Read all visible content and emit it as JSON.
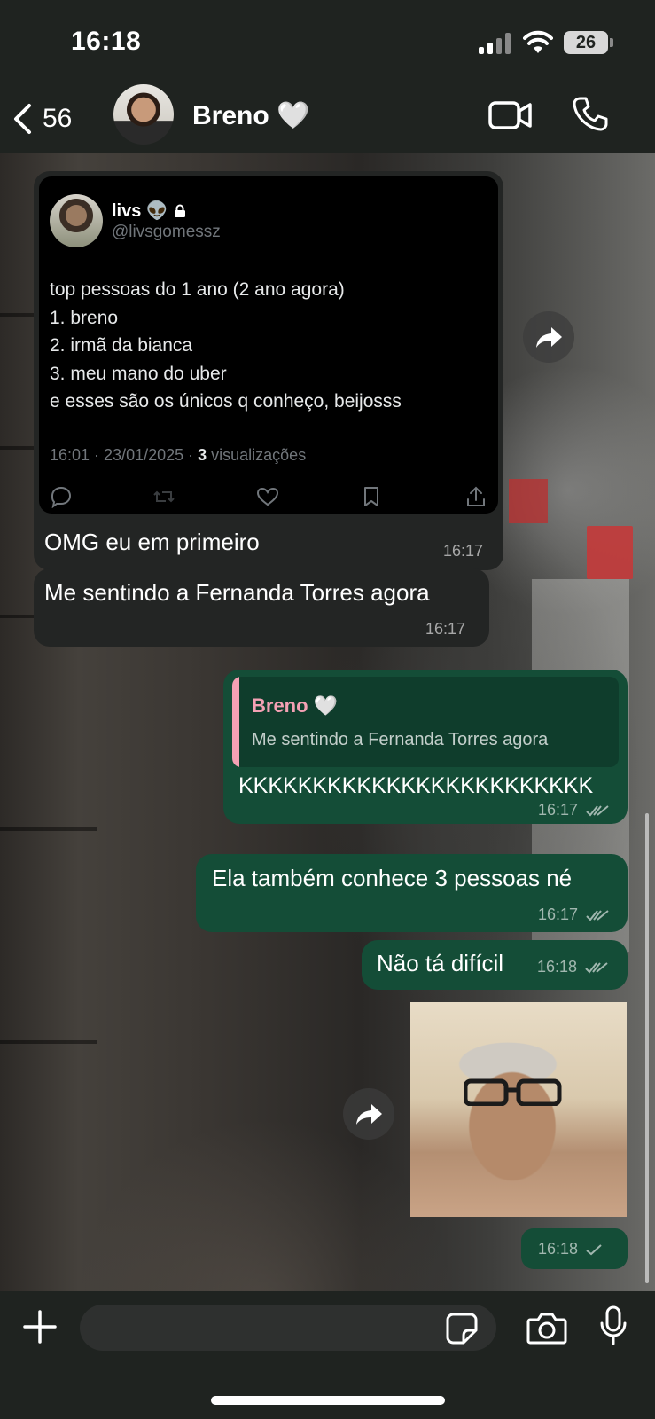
{
  "status_bar": {
    "time": "16:18",
    "battery": "26",
    "icons": [
      "cellular-signal-icon",
      "wifi-icon",
      "battery-icon"
    ]
  },
  "header": {
    "back_count": "56",
    "contact_name": "Breno 🤍",
    "icons": [
      "back-chevron-icon",
      "video-call-icon",
      "phone-icon"
    ]
  },
  "messages": [
    {
      "type": "tweet_share",
      "direction": "incoming",
      "tweet": {
        "display_name": "livs 👽",
        "handle": "@livsgomessz",
        "body": "top pessoas do 1 ano (2 ano agora)\n1. breno\n2. irmã da bianca\n3. meu mano do uber\ne esses são os únicos q conheço, beijosss",
        "meta_prefix": "16:01 · 23/01/2025 · ",
        "views_count": "3",
        "views_label": " visualizações"
      },
      "caption": "OMG eu em primeiro",
      "time": "16:17"
    },
    {
      "type": "text",
      "direction": "incoming",
      "text": "Me sentindo a Fernanda Torres agora",
      "time": "16:17"
    },
    {
      "type": "reply",
      "direction": "outgoing",
      "quoted_name": "Breno 🤍",
      "quoted_text": "Me sentindo a Fernanda Torres agora",
      "text": "KKKKKKKKKKKKKKKKKKKKKKKK",
      "time": "16:17",
      "status": "read"
    },
    {
      "type": "text",
      "direction": "outgoing",
      "text": "Ela também conhece 3 pessoas né",
      "time": "16:17",
      "status": "read"
    },
    {
      "type": "text",
      "direction": "outgoing",
      "text": "Não tá difícil",
      "time": "16:18",
      "status": "read"
    },
    {
      "type": "image",
      "direction": "outgoing",
      "time": "16:18",
      "status": "delivered"
    }
  ],
  "input": {
    "placeholder": "",
    "icons": [
      "plus-icon",
      "sticker-icon",
      "camera-icon",
      "microphone-icon"
    ]
  },
  "colors": {
    "incoming_bubble": "#232524",
    "outgoing_bubble": "#144d37",
    "reply_accent": "#f4a1b4",
    "header_bg": "#1f2320"
  }
}
